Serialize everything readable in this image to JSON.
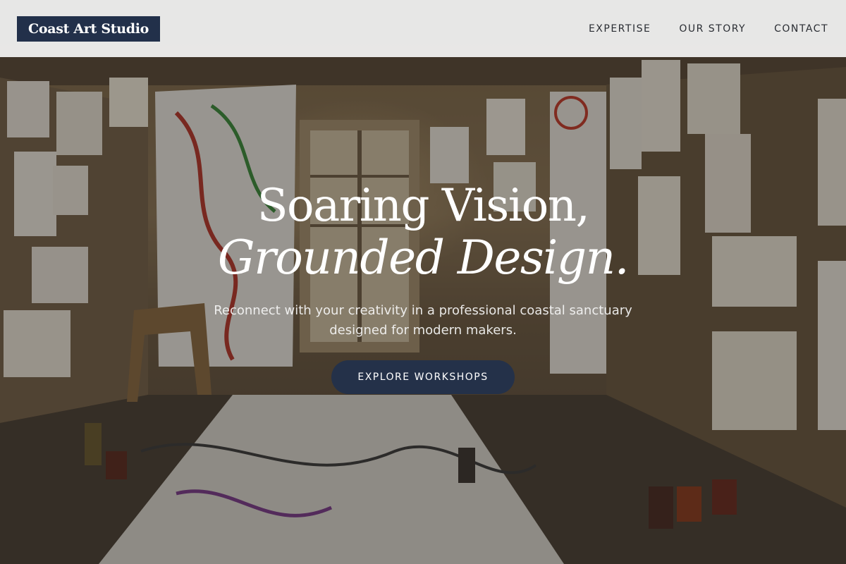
{
  "header": {
    "logo_text": "Coast Art Studio",
    "nav": [
      {
        "label": "EXPERTISE"
      },
      {
        "label": "OUR STORY"
      },
      {
        "label": "CONTACT"
      }
    ]
  },
  "hero": {
    "headline_line1": "Soaring Vision,",
    "headline_line2": "Grounded Design.",
    "subtitle": "Reconnect with your creativity in a professional coastal sanctuary designed for modern makers.",
    "cta_label": "EXPLORE WORKSHOPS",
    "background": "art-studio-photo"
  },
  "colors": {
    "brand_navy": "#22304a",
    "header_bg": "#ececec",
    "nav_text": "#2a2d33",
    "hero_text": "#ffffff"
  }
}
